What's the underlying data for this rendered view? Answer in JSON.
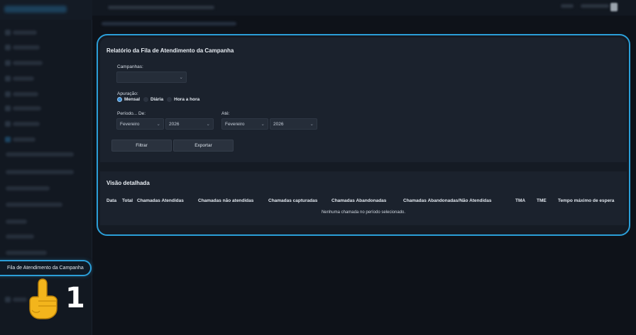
{
  "panel": {
    "title": "Relatório da Fila de Atendimento da Campanha",
    "campaigns_label": "Campanhas:",
    "campaigns_value": "",
    "apuracao_label": "Apuração:",
    "apuracao_options": [
      "Mensal",
      "Diária",
      "Hora a hora"
    ],
    "apuracao_selected": "Mensal",
    "period_from_label": "Período... De:",
    "period_to_label": "Até:",
    "from_month": "Fevereiro",
    "from_year": "2026",
    "to_month": "Fevereiro",
    "to_year": "2026",
    "filter_button": "Filtrar",
    "export_button": "Exportar"
  },
  "detail": {
    "title": "Visão detalhada",
    "columns": [
      "Data",
      "Total",
      "Chamadas Atendidas",
      "Chamadas não atendidas",
      "Chamadas capturadas",
      "Chamadas Abandonadas",
      "Chamadas Abandonadas/Não Atendidas",
      "TMA",
      "TME",
      "Tempo máximo de espera"
    ],
    "empty_message": "Nenhuma chamada no período selecionado."
  },
  "sidebar": {
    "active_item": "Fila de Atendimento da Campanha"
  },
  "annotation": {
    "step": "1"
  },
  "colors": {
    "highlight": "#2b9fd9",
    "background": "#0e1219",
    "card": "#1b222d"
  }
}
